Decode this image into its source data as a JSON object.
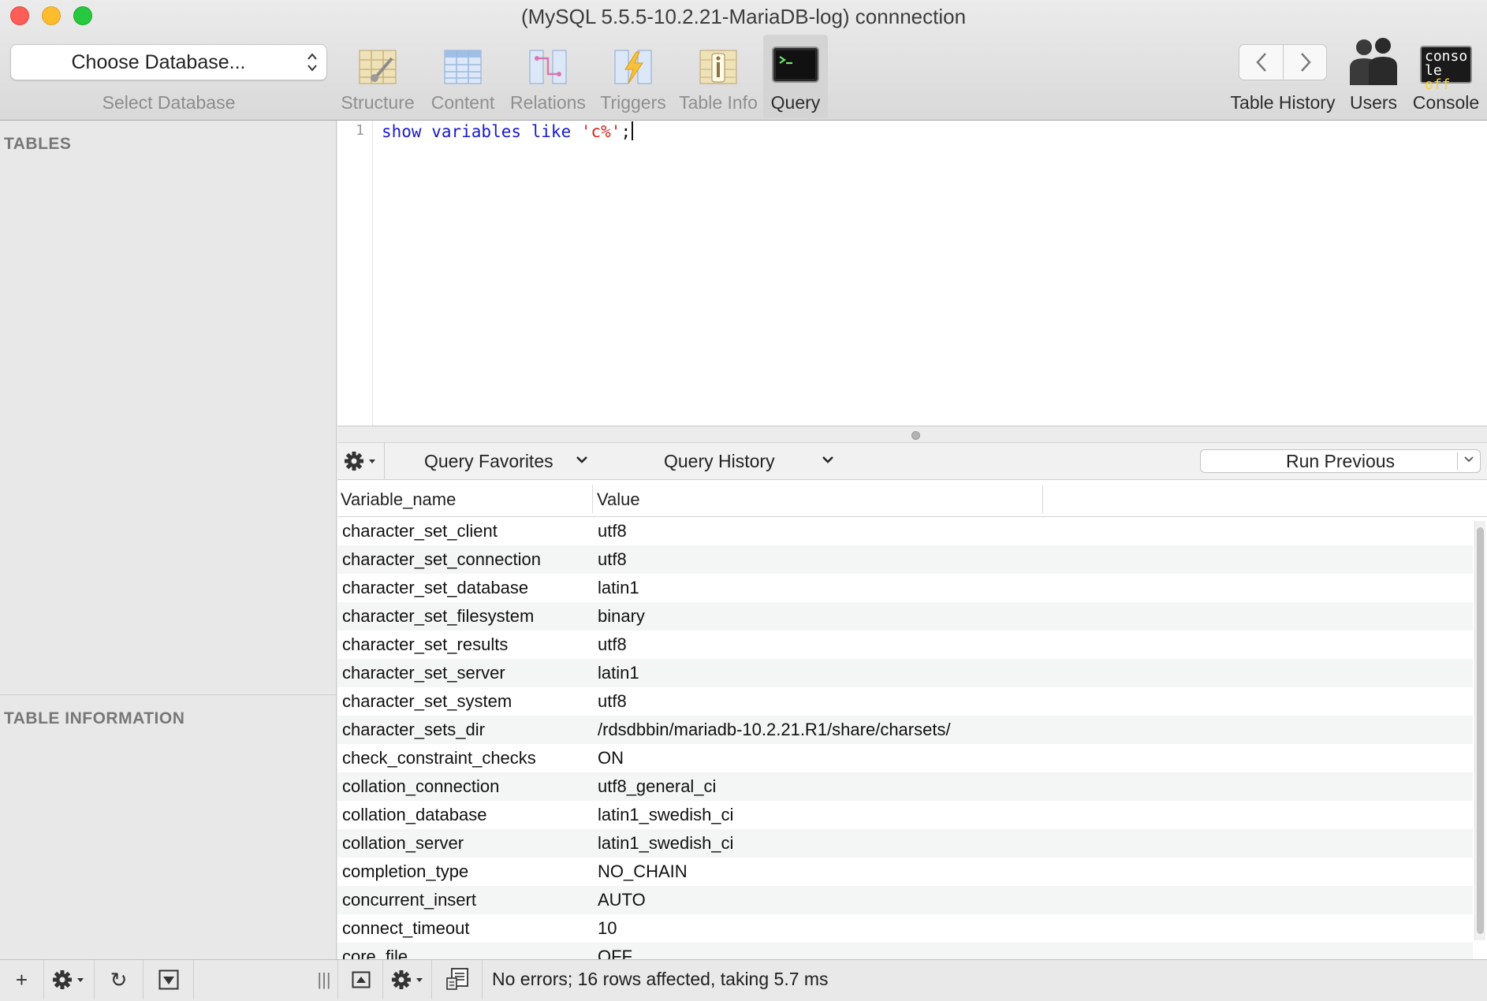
{
  "window": {
    "title": "(MySQL 5.5.5-10.2.21-MariaDB-log) connnection"
  },
  "toolbar": {
    "database_select": {
      "value": "Choose Database...",
      "label": "Select Database"
    },
    "tools": [
      {
        "id": "structure",
        "label": "Structure",
        "icon": "structure-icon"
      },
      {
        "id": "content",
        "label": "Content",
        "icon": "content-grid-icon"
      },
      {
        "id": "relations",
        "label": "Relations",
        "icon": "relations-icon"
      },
      {
        "id": "triggers",
        "label": "Triggers",
        "icon": "triggers-icon"
      },
      {
        "id": "table-info",
        "label": "Table Info",
        "icon": "info-icon"
      },
      {
        "id": "query",
        "label": "Query",
        "icon": "terminal-icon",
        "active": true
      }
    ],
    "right": {
      "table_history": "Table History",
      "users": "Users",
      "console": "Console",
      "console_icon_text": [
        "conso",
        "le",
        "off"
      ]
    }
  },
  "sidebar": {
    "tables_header": "TABLES",
    "table_info_header": "TABLE INFORMATION"
  },
  "editor": {
    "line_number": "1",
    "tokens": {
      "keywords": "show variables like",
      "string": "'c%'",
      "terminator": ";"
    }
  },
  "query_bar": {
    "favorites": "Query Favorites",
    "history": "Query History",
    "run_previous": "Run Previous"
  },
  "results": {
    "columns": [
      "Variable_name",
      "Value"
    ],
    "rows": [
      [
        "character_set_client",
        "utf8"
      ],
      [
        "character_set_connection",
        "utf8"
      ],
      [
        "character_set_database",
        "latin1"
      ],
      [
        "character_set_filesystem",
        "binary"
      ],
      [
        "character_set_results",
        "utf8"
      ],
      [
        "character_set_server",
        "latin1"
      ],
      [
        "character_set_system",
        "utf8"
      ],
      [
        "character_sets_dir",
        "/rdsdbbin/mariadb-10.2.21.R1/share/charsets/"
      ],
      [
        "check_constraint_checks",
        "ON"
      ],
      [
        "collation_connection",
        "utf8_general_ci"
      ],
      [
        "collation_database",
        "latin1_swedish_ci"
      ],
      [
        "collation_server",
        "latin1_swedish_ci"
      ],
      [
        "completion_type",
        "NO_CHAIN"
      ],
      [
        "concurrent_insert",
        "AUTO"
      ],
      [
        "connect_timeout",
        "10"
      ],
      [
        "core_file",
        "OFF"
      ]
    ]
  },
  "status": {
    "message": "No errors; 16 rows affected, taking 5.7 ms"
  },
  "colors": {
    "keyword": "#1a1acc",
    "string": "#d4271e",
    "close": "#fd5d57",
    "minimize": "#fdbc2e",
    "maximize": "#27c840"
  }
}
